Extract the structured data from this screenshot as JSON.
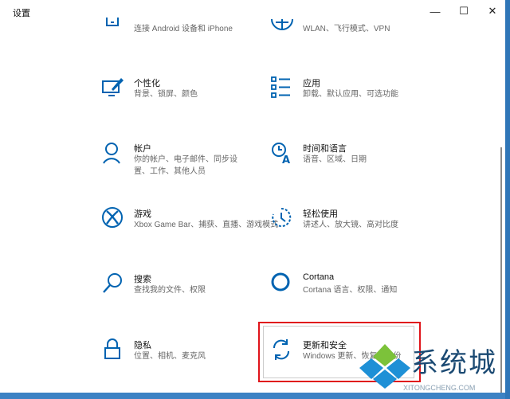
{
  "window": {
    "title": "设置",
    "minimize_glyph": "—",
    "maximize_glyph": "☐",
    "close_glyph": "✕"
  },
  "tiles": [
    {
      "icon": "phone-icon",
      "title": "",
      "desc": "连接 Android 设备和 iPhone"
    },
    {
      "icon": "globe-icon",
      "title": "",
      "desc": "WLAN、飞行模式、VPN"
    },
    {
      "icon": "personalization-icon",
      "title": "个性化",
      "desc": "背景、锁屏、颜色"
    },
    {
      "icon": "apps-icon",
      "title": "应用",
      "desc": "卸载、默认应用、可选功能"
    },
    {
      "icon": "account-icon",
      "title": "帐户",
      "desc": "你的帐户、电子邮件、同步设置、工作、其他人员"
    },
    {
      "icon": "time-language-icon",
      "title": "时间和语言",
      "desc": "语音、区域、日期"
    },
    {
      "icon": "xbox-icon",
      "title": "游戏",
      "desc": "Xbox Game Bar、捕获、直播、游戏模式"
    },
    {
      "icon": "ease-of-access-icon",
      "title": "轻松使用",
      "desc": "讲述人、放大镜、高对比度"
    },
    {
      "icon": "search-icon",
      "title": "搜索",
      "desc": "查找我的文件、权限"
    },
    {
      "icon": "cortana-icon",
      "title": "Cortana",
      "desc": "Cortana 语言、权限、通知"
    },
    {
      "icon": "lock-icon",
      "title": "隐私",
      "desc": "位置、相机、麦克风"
    },
    {
      "icon": "update-icon",
      "title": "更新和安全",
      "desc": "Windows 更新、恢复、备份"
    }
  ],
  "watermark": {
    "text": "系统城",
    "url": "XITONGCHENG.COM"
  },
  "colors": {
    "accent": "#0063b1",
    "highlight_border": "#e0141a"
  }
}
